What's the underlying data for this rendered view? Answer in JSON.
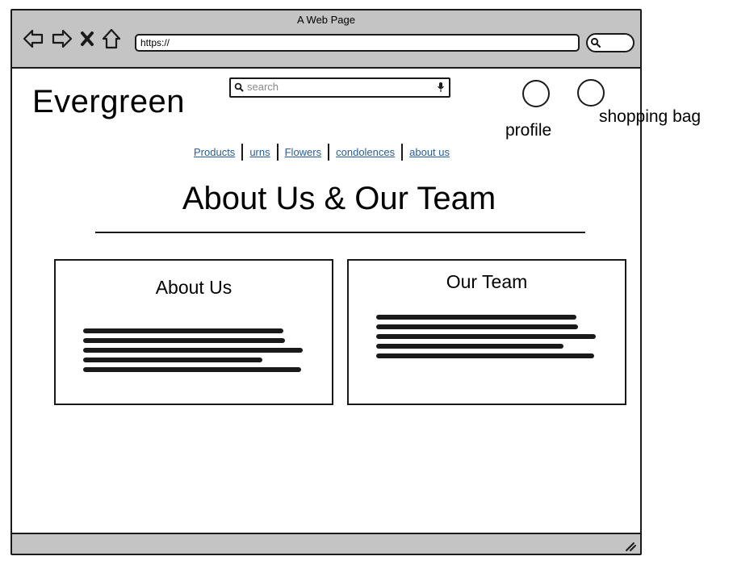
{
  "window": {
    "title": "A Web Page",
    "url": "https://"
  },
  "site": {
    "logo": "Evergreen",
    "search_placeholder": "search",
    "profile_label": "profile",
    "bag_label": "shopping bag"
  },
  "nav": [
    {
      "label": "Products"
    },
    {
      "label": "urns"
    },
    {
      "label": "Flowers"
    },
    {
      "label": "condolences"
    },
    {
      "label": "about us"
    }
  ],
  "page": {
    "heading": "About Us & Our Team"
  },
  "cards": {
    "about": {
      "title": "About Us",
      "text_lines": 5
    },
    "team": {
      "title": "Our Team",
      "text_lines": 5
    }
  }
}
